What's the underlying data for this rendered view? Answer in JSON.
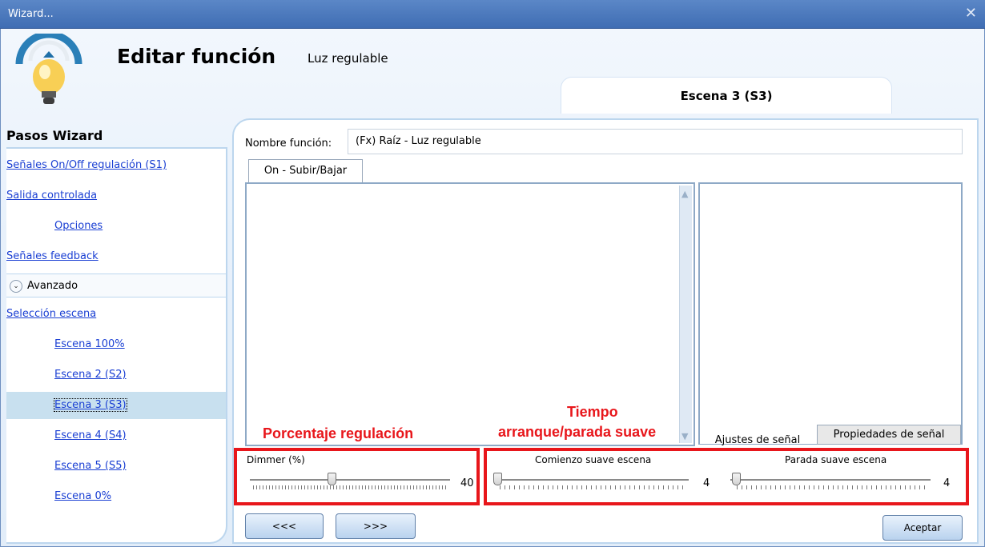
{
  "window": {
    "title": "Wizard...",
    "close_icon": "close-icon"
  },
  "header": {
    "title": "Editar función",
    "subtitle": "Luz regulable",
    "icon": "lightbulb-icon"
  },
  "scene_tab": {
    "label": "Escena 3 (S3)"
  },
  "sidebar": {
    "title": "Pasos Wizard",
    "items": [
      {
        "label": "Señales On/Off regulación (S1)"
      },
      {
        "label": "Salida controlada"
      },
      {
        "label": "Opciones"
      },
      {
        "label": "Señales feedback"
      },
      {
        "label": "Avanzado"
      },
      {
        "label": "Selección escena"
      },
      {
        "label": "Escena 100%"
      },
      {
        "label": "Escena 2 (S2)"
      },
      {
        "label": "Escena 3 (S3)"
      },
      {
        "label": "Escena 4 (S4)"
      },
      {
        "label": "Escena 5 (S5)"
      },
      {
        "label": "Escena 0%"
      }
    ]
  },
  "function_name": {
    "label": "Nombre función:",
    "value": "(Fx) Raíz - Luz regulable"
  },
  "tabs": {
    "on_label": "On - Subir/Bajar",
    "ajustes_label": "Ajustes de señal",
    "props_label": "Propiedades de señal"
  },
  "annotations": {
    "dimmer": "Porcentaje regulación",
    "soft_line1": "Tiempo",
    "soft_line2": "arranque/parada suave"
  },
  "dimmer": {
    "label": "Dimmer (%)",
    "value": "40",
    "level": 0.4
  },
  "soft_start": {
    "label": "Comienzo suave escena",
    "value": "4",
    "level": 0.0
  },
  "soft_stop": {
    "label": "Parada suave escena",
    "value": "4",
    "level": 0.0
  },
  "buttons": {
    "prev": "<<<",
    "next": ">>>",
    "accept": "Aceptar"
  },
  "colors": {
    "accent": "#e8161b",
    "link": "#1a3fd3",
    "selected_bg": "#c8e0ef",
    "titlebar": "#4a78bd"
  }
}
